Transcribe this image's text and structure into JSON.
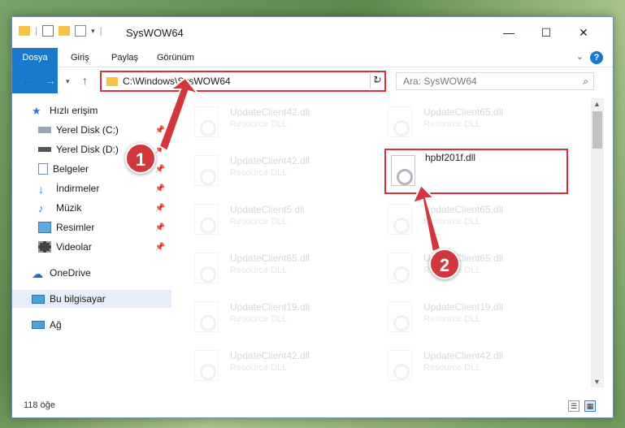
{
  "window": {
    "title": "SysWOW64"
  },
  "ribbon": {
    "tabs": [
      "Dosya",
      "Giriş",
      "Paylaş",
      "Görünüm"
    ],
    "help_label": "?"
  },
  "address": {
    "path": "C:\\Windows\\SysWOW64"
  },
  "search": {
    "placeholder": "Ara: SysWOW64"
  },
  "sidebar": {
    "items": [
      {
        "label": "Hızlı erişim",
        "icon": "star-icon"
      },
      {
        "label": "Yerel Disk (C:)",
        "icon": "drive-icon"
      },
      {
        "label": "Yerel Disk (D:)",
        "icon": "drive-icon"
      },
      {
        "label": "Belgeler",
        "icon": "documents-icon"
      },
      {
        "label": "İndirmeler",
        "icon": "download-icon"
      },
      {
        "label": "Müzik",
        "icon": "music-icon"
      },
      {
        "label": "Resimler",
        "icon": "pictures-icon"
      },
      {
        "label": "Videolar",
        "icon": "video-icon"
      },
      {
        "label": "OneDrive",
        "icon": "cloud-icon"
      },
      {
        "label": "Bu bilgisayar",
        "icon": "computer-icon"
      },
      {
        "label": "Ağ",
        "icon": "network-icon"
      }
    ]
  },
  "files": {
    "left": [
      {
        "name": "UpdateClient42.dll",
        "type": "Resource DLL"
      },
      {
        "name": "UpdateClient42.dll",
        "type": "Resource DLL"
      },
      {
        "name": "UpdateClient5.dll",
        "type": "Resource DLL"
      },
      {
        "name": "UpdateClient65.dll",
        "type": "Resource DLL"
      },
      {
        "name": "UpdateClient19.dll",
        "type": "Resource DLL"
      },
      {
        "name": "UpdateClient42.dll",
        "type": "Resource DLL"
      }
    ],
    "right": [
      {
        "name": "UpdateClient65.dll",
        "type": "Resource DLL"
      },
      {
        "name": "hpbf201f.dll",
        "type": ""
      },
      {
        "name": "UpdateClient65.dll",
        "type": "Resource DLL"
      },
      {
        "name": "UpdateClient65.dll",
        "type": "Resource DLL"
      },
      {
        "name": "UpdateClient19.dll",
        "type": "Resource DLL"
      },
      {
        "name": "UpdateClient42.dll",
        "type": "Resource DLL"
      }
    ]
  },
  "status": {
    "count": "118 öğe"
  },
  "callouts": {
    "one": "1",
    "two": "2"
  },
  "colors": {
    "accent": "#1979ca",
    "highlight": "#d6303a"
  }
}
